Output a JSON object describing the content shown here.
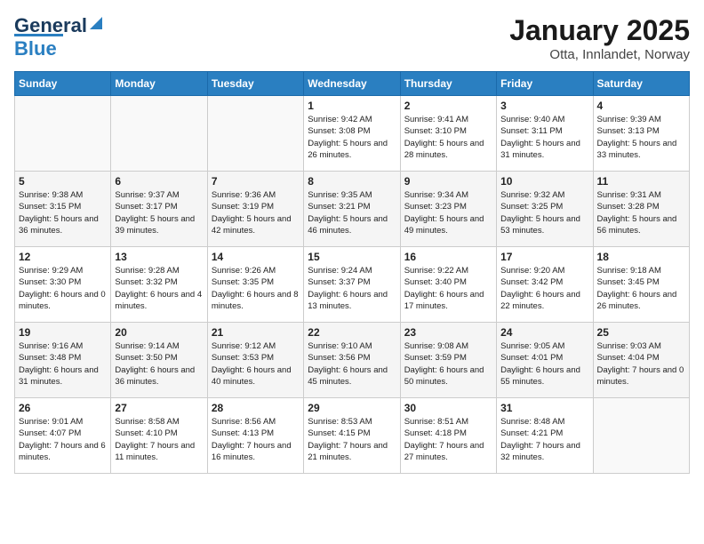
{
  "header": {
    "logo_line1": "General",
    "logo_line2": "Blue",
    "title": "January 2025",
    "subtitle": "Otta, Innlandet, Norway"
  },
  "weekdays": [
    "Sunday",
    "Monday",
    "Tuesday",
    "Wednesday",
    "Thursday",
    "Friday",
    "Saturday"
  ],
  "weeks": [
    [
      {
        "day": "",
        "info": ""
      },
      {
        "day": "",
        "info": ""
      },
      {
        "day": "",
        "info": ""
      },
      {
        "day": "1",
        "info": "Sunrise: 9:42 AM\nSunset: 3:08 PM\nDaylight: 5 hours and 26 minutes."
      },
      {
        "day": "2",
        "info": "Sunrise: 9:41 AM\nSunset: 3:10 PM\nDaylight: 5 hours and 28 minutes."
      },
      {
        "day": "3",
        "info": "Sunrise: 9:40 AM\nSunset: 3:11 PM\nDaylight: 5 hours and 31 minutes."
      },
      {
        "day": "4",
        "info": "Sunrise: 9:39 AM\nSunset: 3:13 PM\nDaylight: 5 hours and 33 minutes."
      }
    ],
    [
      {
        "day": "5",
        "info": "Sunrise: 9:38 AM\nSunset: 3:15 PM\nDaylight: 5 hours and 36 minutes."
      },
      {
        "day": "6",
        "info": "Sunrise: 9:37 AM\nSunset: 3:17 PM\nDaylight: 5 hours and 39 minutes."
      },
      {
        "day": "7",
        "info": "Sunrise: 9:36 AM\nSunset: 3:19 PM\nDaylight: 5 hours and 42 minutes."
      },
      {
        "day": "8",
        "info": "Sunrise: 9:35 AM\nSunset: 3:21 PM\nDaylight: 5 hours and 46 minutes."
      },
      {
        "day": "9",
        "info": "Sunrise: 9:34 AM\nSunset: 3:23 PM\nDaylight: 5 hours and 49 minutes."
      },
      {
        "day": "10",
        "info": "Sunrise: 9:32 AM\nSunset: 3:25 PM\nDaylight: 5 hours and 53 minutes."
      },
      {
        "day": "11",
        "info": "Sunrise: 9:31 AM\nSunset: 3:28 PM\nDaylight: 5 hours and 56 minutes."
      }
    ],
    [
      {
        "day": "12",
        "info": "Sunrise: 9:29 AM\nSunset: 3:30 PM\nDaylight: 6 hours and 0 minutes."
      },
      {
        "day": "13",
        "info": "Sunrise: 9:28 AM\nSunset: 3:32 PM\nDaylight: 6 hours and 4 minutes."
      },
      {
        "day": "14",
        "info": "Sunrise: 9:26 AM\nSunset: 3:35 PM\nDaylight: 6 hours and 8 minutes."
      },
      {
        "day": "15",
        "info": "Sunrise: 9:24 AM\nSunset: 3:37 PM\nDaylight: 6 hours and 13 minutes."
      },
      {
        "day": "16",
        "info": "Sunrise: 9:22 AM\nSunset: 3:40 PM\nDaylight: 6 hours and 17 minutes."
      },
      {
        "day": "17",
        "info": "Sunrise: 9:20 AM\nSunset: 3:42 PM\nDaylight: 6 hours and 22 minutes."
      },
      {
        "day": "18",
        "info": "Sunrise: 9:18 AM\nSunset: 3:45 PM\nDaylight: 6 hours and 26 minutes."
      }
    ],
    [
      {
        "day": "19",
        "info": "Sunrise: 9:16 AM\nSunset: 3:48 PM\nDaylight: 6 hours and 31 minutes."
      },
      {
        "day": "20",
        "info": "Sunrise: 9:14 AM\nSunset: 3:50 PM\nDaylight: 6 hours and 36 minutes."
      },
      {
        "day": "21",
        "info": "Sunrise: 9:12 AM\nSunset: 3:53 PM\nDaylight: 6 hours and 40 minutes."
      },
      {
        "day": "22",
        "info": "Sunrise: 9:10 AM\nSunset: 3:56 PM\nDaylight: 6 hours and 45 minutes."
      },
      {
        "day": "23",
        "info": "Sunrise: 9:08 AM\nSunset: 3:59 PM\nDaylight: 6 hours and 50 minutes."
      },
      {
        "day": "24",
        "info": "Sunrise: 9:05 AM\nSunset: 4:01 PM\nDaylight: 6 hours and 55 minutes."
      },
      {
        "day": "25",
        "info": "Sunrise: 9:03 AM\nSunset: 4:04 PM\nDaylight: 7 hours and 0 minutes."
      }
    ],
    [
      {
        "day": "26",
        "info": "Sunrise: 9:01 AM\nSunset: 4:07 PM\nDaylight: 7 hours and 6 minutes."
      },
      {
        "day": "27",
        "info": "Sunrise: 8:58 AM\nSunset: 4:10 PM\nDaylight: 7 hours and 11 minutes."
      },
      {
        "day": "28",
        "info": "Sunrise: 8:56 AM\nSunset: 4:13 PM\nDaylight: 7 hours and 16 minutes."
      },
      {
        "day": "29",
        "info": "Sunrise: 8:53 AM\nSunset: 4:15 PM\nDaylight: 7 hours and 21 minutes."
      },
      {
        "day": "30",
        "info": "Sunrise: 8:51 AM\nSunset: 4:18 PM\nDaylight: 7 hours and 27 minutes."
      },
      {
        "day": "31",
        "info": "Sunrise: 8:48 AM\nSunset: 4:21 PM\nDaylight: 7 hours and 32 minutes."
      },
      {
        "day": "",
        "info": ""
      }
    ]
  ]
}
